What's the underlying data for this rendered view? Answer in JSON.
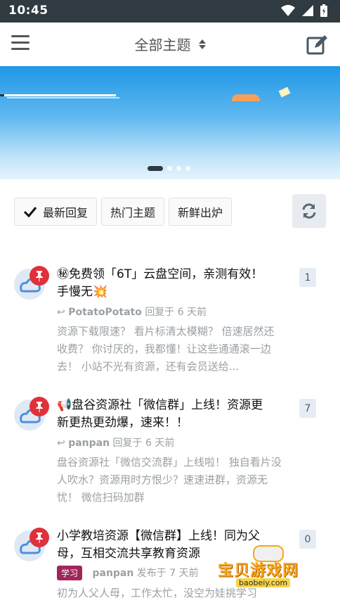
{
  "status": {
    "time": "10:45"
  },
  "header": {
    "title": "全部主题"
  },
  "tabs": [
    {
      "label": "最新回复",
      "active": true
    },
    {
      "label": "热门主题",
      "active": false
    },
    {
      "label": "新鲜出炉",
      "active": false
    }
  ],
  "posts": [
    {
      "title": "㊙免费领「6T」云盘空间，亲测有效！手慢无💥",
      "user": "PotatoPotato",
      "action": "回复于 6 天前",
      "excerpt": "资源下载限速？ 看片标清太模糊？ 倍速居然还收费？ 你讨厌的，我都懂！让这些通通滚一边去！ 小站不光有资源，还有会员送给...",
      "count": "1"
    },
    {
      "title": "📢盘谷资源社「微信群」上线！资源更新更热更劲爆，速来！！",
      "user": "panpan",
      "action": "回复于 6 天前",
      "excerpt": "盘谷资源社「微信交流群」上线啦！ 独自看片没人吹水？资源用时方恨少？速速进群，资源无忧！ 微信扫码加群",
      "count": "7"
    },
    {
      "title": "小学教培资源【微信群】上线！同为父母，互相交流共享教育资源",
      "tag": "学习",
      "user": "panpan",
      "action": "发布于 7 天前",
      "excerpt": "初为人父人母，工作太忙，没空为娃挑学习",
      "count": "0"
    }
  ],
  "watermark": {
    "text": "宝贝游戏网",
    "url": "baobeiy.com"
  },
  "colors": {
    "pin": "#e0303a",
    "tag": "#a2255a",
    "statusbar": "#2f3b40"
  }
}
